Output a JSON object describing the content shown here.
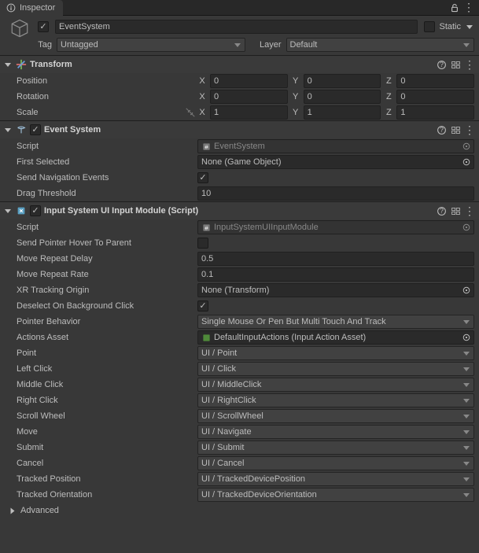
{
  "tab": {
    "title": "Inspector"
  },
  "gameObject": {
    "name": "EventSystem",
    "staticLabel": "Static",
    "tagLabel": "Tag",
    "tagValue": "Untagged",
    "layerLabel": "Layer",
    "layerValue": "Default"
  },
  "transform": {
    "title": "Transform",
    "position": {
      "label": "Position",
      "x": "0",
      "y": "0",
      "z": "0"
    },
    "rotation": {
      "label": "Rotation",
      "x": "0",
      "y": "0",
      "z": "0"
    },
    "scale": {
      "label": "Scale",
      "x": "1",
      "y": "1",
      "z": "1"
    }
  },
  "eventSystem": {
    "title": "Event System",
    "script": {
      "label": "Script",
      "value": "EventSystem"
    },
    "firstSelected": {
      "label": "First Selected",
      "value": "None (Game Object)"
    },
    "sendNav": {
      "label": "Send Navigation Events"
    },
    "dragThreshold": {
      "label": "Drag Threshold",
      "value": "10"
    }
  },
  "inputModule": {
    "title": "Input System UI Input Module (Script)",
    "script": {
      "label": "Script",
      "value": "InputSystemUIInputModule"
    },
    "sendHover": {
      "label": "Send Pointer Hover To Parent"
    },
    "moveRepeatDelay": {
      "label": "Move Repeat Delay",
      "value": "0.5"
    },
    "moveRepeatRate": {
      "label": "Move Repeat Rate",
      "value": "0.1"
    },
    "xrOrigin": {
      "label": "XR Tracking Origin",
      "value": "None (Transform)"
    },
    "deselect": {
      "label": "Deselect On Background Click"
    },
    "pointerBehavior": {
      "label": "Pointer Behavior",
      "value": "Single Mouse Or Pen But Multi Touch And Track"
    },
    "actionsAsset": {
      "label": "Actions Asset",
      "value": "DefaultInputActions (Input Action Asset)"
    },
    "point": {
      "label": "Point",
      "value": "UI / Point"
    },
    "leftClick": {
      "label": "Left Click",
      "value": "UI / Click"
    },
    "middleClick": {
      "label": "Middle Click",
      "value": "UI / MiddleClick"
    },
    "rightClick": {
      "label": "Right Click",
      "value": "UI / RightClick"
    },
    "scroll": {
      "label": "Scroll Wheel",
      "value": "UI / ScrollWheel"
    },
    "move": {
      "label": "Move",
      "value": "UI / Navigate"
    },
    "submit": {
      "label": "Submit",
      "value": "UI / Submit"
    },
    "cancel": {
      "label": "Cancel",
      "value": "UI / Cancel"
    },
    "trackedPos": {
      "label": "Tracked Position",
      "value": "UI / TrackedDevicePosition"
    },
    "trackedOri": {
      "label": "Tracked Orientation",
      "value": "UI / TrackedDeviceOrientation"
    },
    "advanced": {
      "label": "Advanced"
    }
  }
}
